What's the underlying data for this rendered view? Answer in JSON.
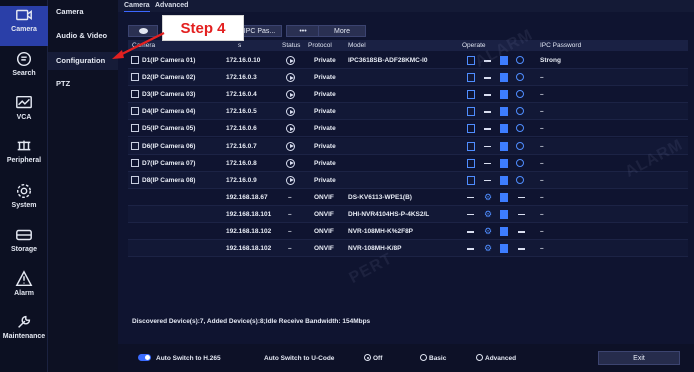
{
  "rail": [
    {
      "id": "camera",
      "label": "Camera",
      "icon": "camera-icon",
      "active": true
    },
    {
      "id": "search",
      "label": "Search",
      "icon": "search-icon"
    },
    {
      "id": "vca",
      "label": "VCA",
      "icon": "vca-icon"
    },
    {
      "id": "peripheral",
      "label": "Peripheral",
      "icon": "peripheral-icon"
    },
    {
      "id": "system",
      "label": "System",
      "icon": "gear-icon"
    },
    {
      "id": "storage",
      "label": "Storage",
      "icon": "storage-icon"
    },
    {
      "id": "alarm",
      "label": "Alarm",
      "icon": "alarm-icon"
    },
    {
      "id": "maintenance",
      "label": "Maintenance",
      "icon": "wrench-icon"
    }
  ],
  "submenu": [
    "Camera",
    "Audio & Video",
    "Configuration",
    "PTZ"
  ],
  "tabs": [
    "Camera",
    "Advanced"
  ],
  "toolbar": {
    "first_icon": "eye-icon",
    "ipc_pass_label": "w IPC Pas...",
    "dots_label": "•••",
    "more_label": "More"
  },
  "callout": {
    "text": "Step 4",
    "color": "#e32020"
  },
  "table": {
    "headers": {
      "camera": "Camera",
      "ip": "s",
      "status": "Status",
      "protocol": "Protocol",
      "model": "Model",
      "operate": "Operate",
      "ipc_password": "IPC Password"
    },
    "rows": [
      {
        "camera": "D1(IP Camera 01)",
        "ip": "172.16.0.10",
        "status": "play",
        "protocol": "Private",
        "model": "IPC3618SB-ADF28KMC-I0",
        "password": "Strong"
      },
      {
        "camera": "D2(IP Camera 02)",
        "ip": "172.16.0.3",
        "status": "play",
        "protocol": "Private",
        "model": "",
        "password": "–"
      },
      {
        "camera": "D3(IP Camera 03)",
        "ip": "172.16.0.4",
        "status": "play",
        "protocol": "Private",
        "model": "",
        "password": "–"
      },
      {
        "camera": "D4(IP Camera 04)",
        "ip": "172.16.0.5",
        "status": "play",
        "protocol": "Private",
        "model": "",
        "password": "–"
      },
      {
        "camera": "D5(IP Camera 05)",
        "ip": "172.16.0.6",
        "status": "play",
        "protocol": "Private",
        "model": "",
        "password": "–"
      },
      {
        "camera": "D6(IP Camera 06)",
        "ip": "172.16.0.7",
        "status": "play",
        "protocol": "Private",
        "model": "",
        "password": "–"
      },
      {
        "camera": "D7(IP Camera 07)",
        "ip": "172.16.0.8",
        "status": "play",
        "protocol": "Private",
        "model": "",
        "password": "–"
      },
      {
        "camera": "D8(IP Camera 08)",
        "ip": "172.16.0.9",
        "status": "play",
        "protocol": "Private",
        "model": "",
        "password": "–"
      },
      {
        "camera": "",
        "ip": "192.168.18.67",
        "status": "–",
        "protocol": "ONVIF",
        "model": "DS-KV6113-WPE1(B)",
        "password": "–"
      },
      {
        "camera": "",
        "ip": "192.168.18.101",
        "status": "–",
        "protocol": "ONVIF",
        "model": "DHI-NVR4104HS-P-4KS2/L",
        "password": "–"
      },
      {
        "camera": "",
        "ip": "192.168.18.102",
        "status": "–",
        "protocol": "ONVIF",
        "model": "NVR-108MH-K%2F8P",
        "password": "–"
      },
      {
        "camera": "",
        "ip": "192.168.18.102",
        "status": "–",
        "protocol": "ONVIF",
        "model": "NVR-108MH-K/8P",
        "password": "–"
      }
    ]
  },
  "status_text": "Discovered Device(s):7, Added Device(s):8;Idle Receive Bandwidth: 154Mbps",
  "bottom": {
    "auto_h265": "Auto Switch to H.265",
    "auto_ucode": "Auto Switch to U-Code",
    "options": [
      "Off",
      "Basic",
      "Advanced"
    ],
    "selected": "Off",
    "exit_label": "Exit"
  },
  "colors": {
    "accent": "#3c67ff",
    "active_rail": "#2a3fa8"
  }
}
